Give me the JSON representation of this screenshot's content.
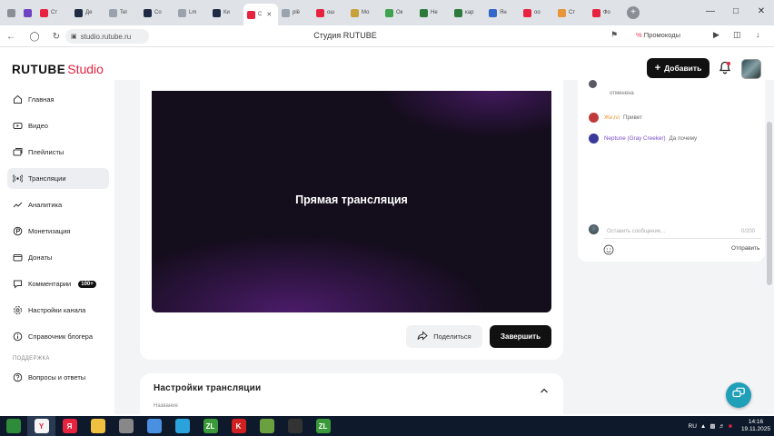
{
  "browser": {
    "tabs": [
      {
        "label": "",
        "color": "#8a8f96",
        "active": false
      },
      {
        "label": "",
        "color": "#6e42c1",
        "active": false
      },
      {
        "label": "Ст",
        "color": "#e8233f",
        "active": false
      },
      {
        "label": "Де",
        "color": "#1f2a44",
        "active": false
      },
      {
        "label": "Tel",
        "color": "#9aa3ad",
        "active": false
      },
      {
        "label": "Со",
        "color": "#1f2a44",
        "active": false
      },
      {
        "label": "Lm",
        "color": "#9aa3ad",
        "active": false
      },
      {
        "label": "Ки",
        "color": "#1f2a44",
        "active": false
      },
      {
        "label": "С",
        "color": "#e8233f",
        "active": true
      },
      {
        "label": "plё",
        "color": "#9aa3ad",
        "active": false
      },
      {
        "label": "ош",
        "color": "#e8233f",
        "active": false
      },
      {
        "label": "Мо",
        "color": "#c7a23a",
        "active": false
      },
      {
        "label": "Ок",
        "color": "#3fa34d",
        "active": false
      },
      {
        "label": "Не",
        "color": "#2d7a3a",
        "active": false
      },
      {
        "label": "кар",
        "color": "#2d7a3a",
        "active": false
      },
      {
        "label": "Ян",
        "color": "#3566c9",
        "active": false
      },
      {
        "label": "оо",
        "color": "#e8233f",
        "active": false
      },
      {
        "label": "Ст",
        "color": "#e8943a",
        "active": false
      },
      {
        "label": "Фо",
        "color": "#e8233f",
        "active": false
      }
    ],
    "url": "studio.rutube.ru",
    "page_title": "Студия RUTUBE",
    "promo_label": "Промокоды",
    "promo_icon": "%"
  },
  "studio": {
    "logo_main": "RUTUBE",
    "logo_sub": "Studio",
    "add_button": "Добавить"
  },
  "sidebar": {
    "items": [
      {
        "label": "Главная",
        "icon": "home-icon"
      },
      {
        "label": "Видео",
        "icon": "video-icon"
      },
      {
        "label": "Плейлисты",
        "icon": "playlist-icon"
      },
      {
        "label": "Трансляции",
        "icon": "broadcast-icon",
        "active": true
      },
      {
        "label": "Аналитика",
        "icon": "analytics-icon"
      },
      {
        "label": "Монетизация",
        "icon": "monetization-icon"
      },
      {
        "label": "Донаты",
        "icon": "donate-icon"
      },
      {
        "label": "Комментарии",
        "icon": "comments-icon",
        "badge": "100+"
      },
      {
        "label": "Настройки канала",
        "icon": "settings-icon"
      },
      {
        "label": "Справочник блогера",
        "icon": "info-icon"
      }
    ],
    "support_caption": "ПОДДЕРЖКА",
    "support_item": "Вопросы и ответы"
  },
  "player": {
    "title": "Прямая трансляция"
  },
  "actions": {
    "share": "Поделиться",
    "finish": "Завершить"
  },
  "settings_card": {
    "title": "Настройки трансляции",
    "field_label": "Название"
  },
  "chat": {
    "top_text": "отменена",
    "messages": [
      {
        "name": "Же,ivi",
        "text": "Привет",
        "name_color": "#e89a3a",
        "avatar_color": "#c03a3a"
      },
      {
        "name": "Neptune (Gray Creeker)",
        "text": "Да почему",
        "name_color": "#7a4fc9",
        "avatar_color": "#3a3a9a"
      }
    ],
    "input_placeholder": "Оставить сообщение...",
    "counter": "0/200",
    "send": "Отправить"
  },
  "taskbar": {
    "apps": [
      {
        "name": "start-icon",
        "color": "#2e8b3a",
        "text": ""
      },
      {
        "name": "yandex-browser-icon",
        "color": "#f5f5f5",
        "text": "Y"
      },
      {
        "name": "yandex-icon",
        "color": "#e8233f",
        "text": "Я"
      },
      {
        "name": "explorer-icon",
        "color": "#f0c040",
        "text": ""
      },
      {
        "name": "media-icon",
        "color": "#888888",
        "text": ""
      },
      {
        "name": "chrome-icon",
        "color": "#4a8fe0",
        "text": ""
      },
      {
        "name": "telegram-icon",
        "color": "#2aa3dd",
        "text": ""
      },
      {
        "name": "zl-icon",
        "color": "#3a9a3a",
        "text": "ZL"
      },
      {
        "name": "kaspersky-icon",
        "color": "#d02020",
        "text": "K"
      },
      {
        "name": "minecraft-icon",
        "color": "#6aa040",
        "text": ""
      },
      {
        "name": "obs-icon",
        "color": "#333333",
        "text": ""
      },
      {
        "name": "zl2-icon",
        "color": "#3a9a3a",
        "text": "ZL"
      }
    ],
    "lang": "RU",
    "time": "14:16",
    "date": "19.11.2025"
  }
}
